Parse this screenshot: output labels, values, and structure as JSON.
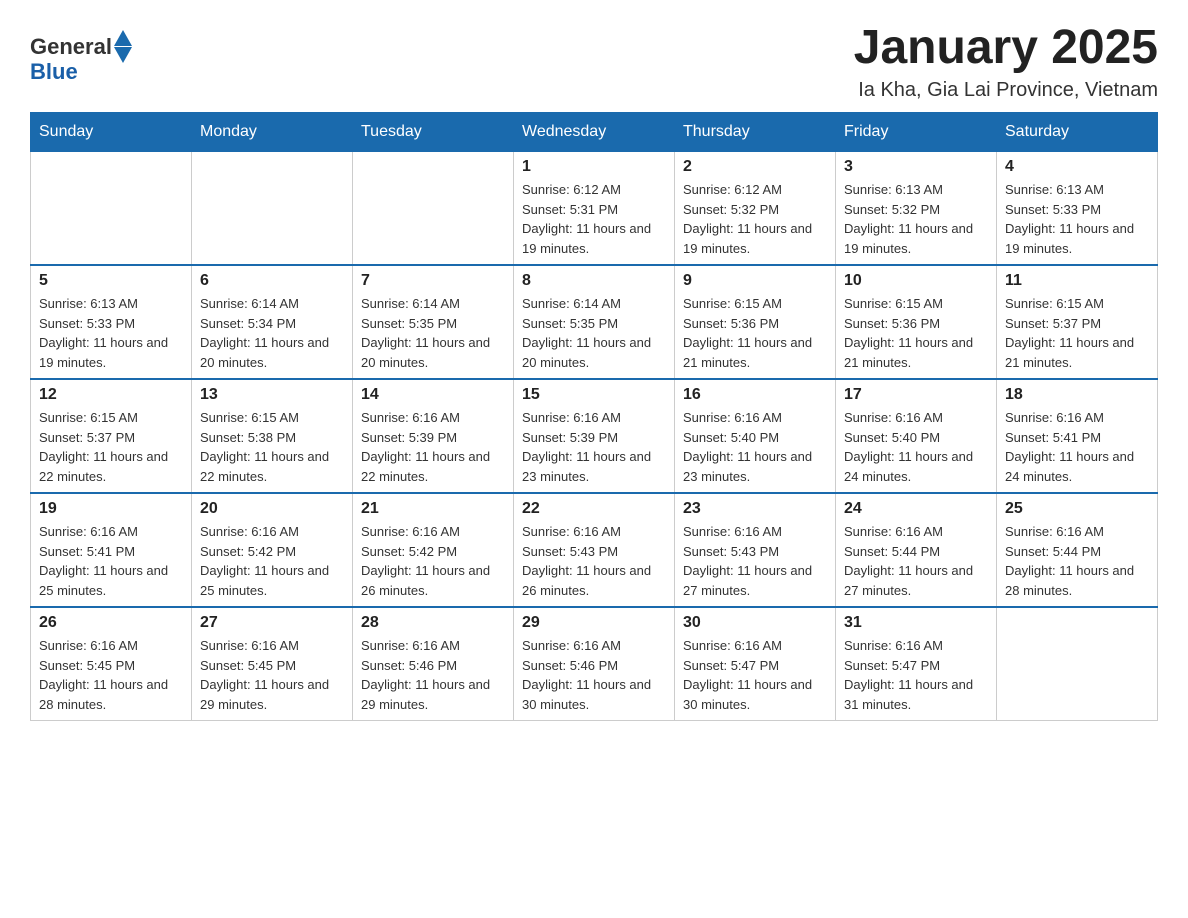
{
  "logo": {
    "text_general": "General",
    "text_blue": "Blue"
  },
  "title": "January 2025",
  "subtitle": "Ia Kha, Gia Lai Province, Vietnam",
  "days_of_week": [
    "Sunday",
    "Monday",
    "Tuesday",
    "Wednesday",
    "Thursday",
    "Friday",
    "Saturday"
  ],
  "weeks": [
    [
      {
        "day": "",
        "info": ""
      },
      {
        "day": "",
        "info": ""
      },
      {
        "day": "",
        "info": ""
      },
      {
        "day": "1",
        "info": "Sunrise: 6:12 AM\nSunset: 5:31 PM\nDaylight: 11 hours and 19 minutes."
      },
      {
        "day": "2",
        "info": "Sunrise: 6:12 AM\nSunset: 5:32 PM\nDaylight: 11 hours and 19 minutes."
      },
      {
        "day": "3",
        "info": "Sunrise: 6:13 AM\nSunset: 5:32 PM\nDaylight: 11 hours and 19 minutes."
      },
      {
        "day": "4",
        "info": "Sunrise: 6:13 AM\nSunset: 5:33 PM\nDaylight: 11 hours and 19 minutes."
      }
    ],
    [
      {
        "day": "5",
        "info": "Sunrise: 6:13 AM\nSunset: 5:33 PM\nDaylight: 11 hours and 19 minutes."
      },
      {
        "day": "6",
        "info": "Sunrise: 6:14 AM\nSunset: 5:34 PM\nDaylight: 11 hours and 20 minutes."
      },
      {
        "day": "7",
        "info": "Sunrise: 6:14 AM\nSunset: 5:35 PM\nDaylight: 11 hours and 20 minutes."
      },
      {
        "day": "8",
        "info": "Sunrise: 6:14 AM\nSunset: 5:35 PM\nDaylight: 11 hours and 20 minutes."
      },
      {
        "day": "9",
        "info": "Sunrise: 6:15 AM\nSunset: 5:36 PM\nDaylight: 11 hours and 21 minutes."
      },
      {
        "day": "10",
        "info": "Sunrise: 6:15 AM\nSunset: 5:36 PM\nDaylight: 11 hours and 21 minutes."
      },
      {
        "day": "11",
        "info": "Sunrise: 6:15 AM\nSunset: 5:37 PM\nDaylight: 11 hours and 21 minutes."
      }
    ],
    [
      {
        "day": "12",
        "info": "Sunrise: 6:15 AM\nSunset: 5:37 PM\nDaylight: 11 hours and 22 minutes."
      },
      {
        "day": "13",
        "info": "Sunrise: 6:15 AM\nSunset: 5:38 PM\nDaylight: 11 hours and 22 minutes."
      },
      {
        "day": "14",
        "info": "Sunrise: 6:16 AM\nSunset: 5:39 PM\nDaylight: 11 hours and 22 minutes."
      },
      {
        "day": "15",
        "info": "Sunrise: 6:16 AM\nSunset: 5:39 PM\nDaylight: 11 hours and 23 minutes."
      },
      {
        "day": "16",
        "info": "Sunrise: 6:16 AM\nSunset: 5:40 PM\nDaylight: 11 hours and 23 minutes."
      },
      {
        "day": "17",
        "info": "Sunrise: 6:16 AM\nSunset: 5:40 PM\nDaylight: 11 hours and 24 minutes."
      },
      {
        "day": "18",
        "info": "Sunrise: 6:16 AM\nSunset: 5:41 PM\nDaylight: 11 hours and 24 minutes."
      }
    ],
    [
      {
        "day": "19",
        "info": "Sunrise: 6:16 AM\nSunset: 5:41 PM\nDaylight: 11 hours and 25 minutes."
      },
      {
        "day": "20",
        "info": "Sunrise: 6:16 AM\nSunset: 5:42 PM\nDaylight: 11 hours and 25 minutes."
      },
      {
        "day": "21",
        "info": "Sunrise: 6:16 AM\nSunset: 5:42 PM\nDaylight: 11 hours and 26 minutes."
      },
      {
        "day": "22",
        "info": "Sunrise: 6:16 AM\nSunset: 5:43 PM\nDaylight: 11 hours and 26 minutes."
      },
      {
        "day": "23",
        "info": "Sunrise: 6:16 AM\nSunset: 5:43 PM\nDaylight: 11 hours and 27 minutes."
      },
      {
        "day": "24",
        "info": "Sunrise: 6:16 AM\nSunset: 5:44 PM\nDaylight: 11 hours and 27 minutes."
      },
      {
        "day": "25",
        "info": "Sunrise: 6:16 AM\nSunset: 5:44 PM\nDaylight: 11 hours and 28 minutes."
      }
    ],
    [
      {
        "day": "26",
        "info": "Sunrise: 6:16 AM\nSunset: 5:45 PM\nDaylight: 11 hours and 28 minutes."
      },
      {
        "day": "27",
        "info": "Sunrise: 6:16 AM\nSunset: 5:45 PM\nDaylight: 11 hours and 29 minutes."
      },
      {
        "day": "28",
        "info": "Sunrise: 6:16 AM\nSunset: 5:46 PM\nDaylight: 11 hours and 29 minutes."
      },
      {
        "day": "29",
        "info": "Sunrise: 6:16 AM\nSunset: 5:46 PM\nDaylight: 11 hours and 30 minutes."
      },
      {
        "day": "30",
        "info": "Sunrise: 6:16 AM\nSunset: 5:47 PM\nDaylight: 11 hours and 30 minutes."
      },
      {
        "day": "31",
        "info": "Sunrise: 6:16 AM\nSunset: 5:47 PM\nDaylight: 11 hours and 31 minutes."
      },
      {
        "day": "",
        "info": ""
      }
    ]
  ]
}
